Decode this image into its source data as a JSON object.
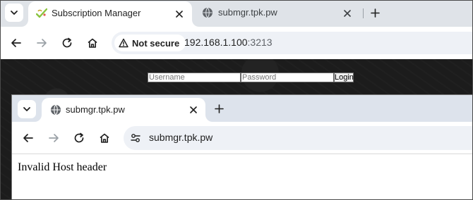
{
  "outer_browser": {
    "tabs": [
      {
        "title": "Subscription Manager",
        "active": true,
        "icon": "checkmark-leaf-favicon"
      },
      {
        "title": "submgr.tpk.pw",
        "active": false,
        "icon": "globe-icon"
      }
    ],
    "address_bar": {
      "security_label": "Not secure",
      "url_host": "192.168.1.100",
      "url_port": ":3213"
    }
  },
  "login_form": {
    "username_placeholder": "Username",
    "password_placeholder": "Password",
    "login_label": "Login"
  },
  "inner_browser": {
    "tabs": [
      {
        "title": "submgr.tpk.pw",
        "active": true,
        "icon": "globe-icon"
      }
    ],
    "address_bar": {
      "url": "submgr.tpk.pw"
    },
    "page": {
      "message": "Invalid Host header"
    }
  },
  "colors": {
    "tabstrip": "#dfe3e8",
    "omnibox": "#eef1f6",
    "page_dark_background": "#1c1c1c",
    "favicon_green": "#8ac43f"
  }
}
